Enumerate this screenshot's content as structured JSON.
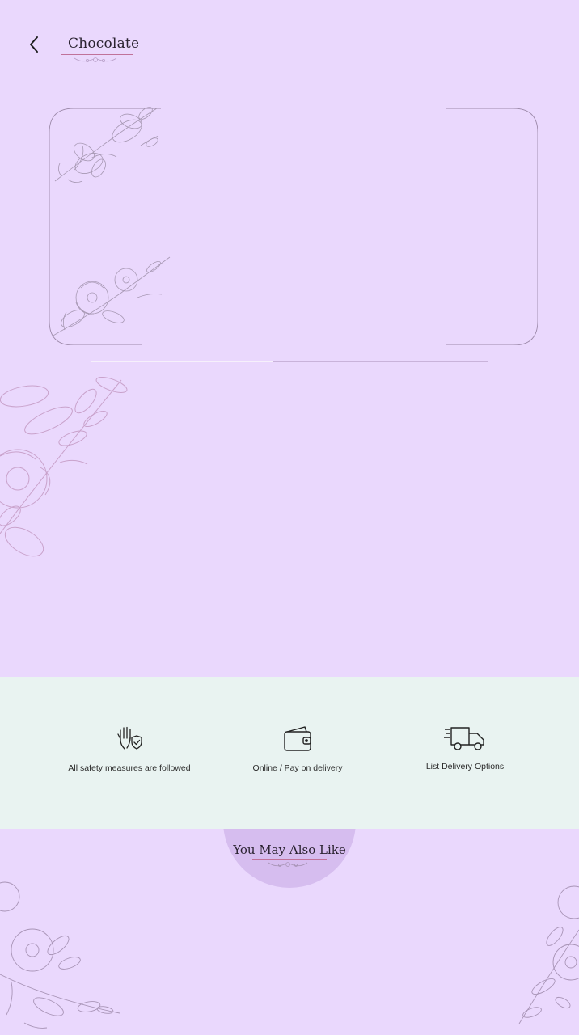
{
  "header": {
    "back_icon": "chevron-left-icon",
    "title": "Chocolate"
  },
  "product_gallery": {
    "slide_progress": 0.46
  },
  "features": [
    {
      "icon": "hand-shield-icon",
      "label": "All safety measures are followed"
    },
    {
      "icon": "wallet-icon",
      "label": "Online / Pay on delivery"
    },
    {
      "icon": "delivery-truck-icon",
      "label": "List Delivery Options"
    }
  ],
  "recommendations": {
    "title": "You May Also Like"
  },
  "colors": {
    "background": "#ead8fd",
    "features_band": "#e9f3f1",
    "accent_underline": "#c0729a",
    "circle_badge": "#d6bdef"
  }
}
